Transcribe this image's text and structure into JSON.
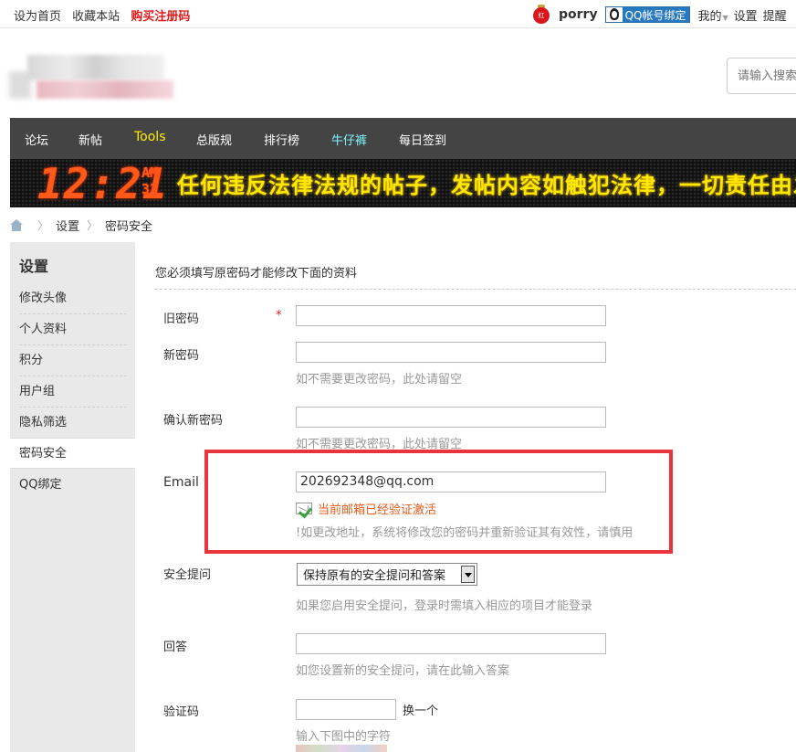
{
  "topbar": {
    "set_home": "设为首页",
    "bookmark": "收藏本站",
    "buy_code": "购买注册码",
    "lantern_char": "红",
    "username": "porry",
    "qq_bind": "QQ帐号绑定",
    "mine": "我的",
    "settings": "设置",
    "remind": "提醒"
  },
  "search": {
    "placeholder": "请输入搜索"
  },
  "nav": {
    "items": [
      "论坛",
      "新帖",
      "Tools",
      "总版规",
      "排行榜",
      "牛仔裤",
      "每日签到"
    ]
  },
  "led": {
    "clock": "12:21",
    "ampm": "AM",
    "seconds": "32",
    "ticker": "任何违反法律法规的帖子，发帖内容如触犯法律，一切责任由发"
  },
  "breadcrumb": {
    "level1": "设置",
    "level2": "密码安全"
  },
  "sidebar": {
    "title": "设置",
    "items": [
      "修改头像",
      "个人资料",
      "积分",
      "用户组",
      "隐私筛选",
      "密码安全",
      "QQ绑定"
    ]
  },
  "form": {
    "notice": "您必须填写原密码才能修改下面的资料",
    "old_password_label": "旧密码",
    "required_mark": "*",
    "new_password_label": "新密码",
    "new_password_hint": "如不需要更改密码，此处请留空",
    "confirm_password_label": "确认新密码",
    "confirm_password_hint": "如不需要更改密码，此处请留空",
    "email_label": "Email",
    "email_value": "202692348@qq.com",
    "email_verified": "当前邮箱已经验证激活",
    "email_hint": "!如更改地址，系统将修改您的密码并重新验证其有效性，请慎用",
    "security_question_label": "安全提问",
    "security_question_value": "保持原有的安全提问和答案",
    "security_question_hint": "如果您启用安全提问，登录时需填入相应的项目才能登录",
    "answer_label": "回答",
    "answer_hint": "如您设置新的安全提问，请在此输入答案",
    "captcha_label": "验证码",
    "captcha_change": "换一个",
    "captcha_hint": "输入下图中的字符"
  },
  "colors": {
    "nav_bg": "#444444",
    "tools": "#ffee00",
    "jeans": "#7df5ff",
    "highlight": "#e8343c",
    "buy": "#e41a1a"
  }
}
